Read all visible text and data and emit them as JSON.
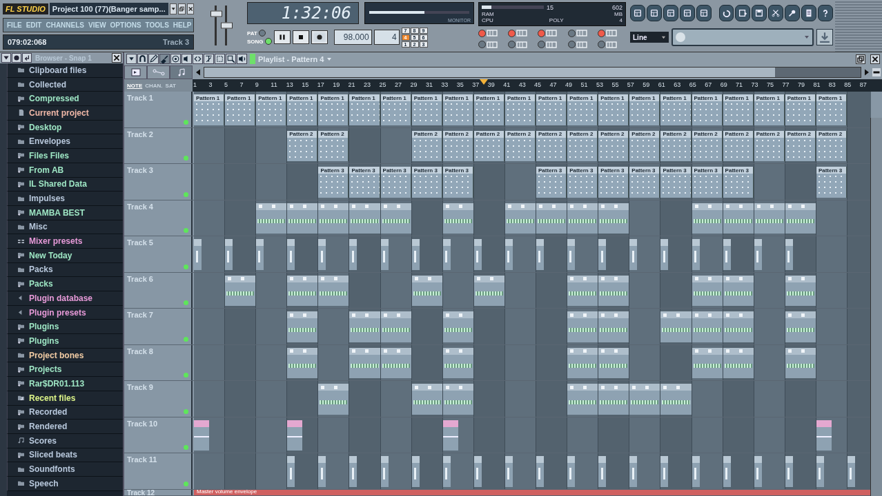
{
  "app": {
    "logo": "FL STUDIO",
    "title": "Project 100 (77)(Banger samp...",
    "menu": [
      "FILE",
      "EDIT",
      "CHANNELS",
      "VIEW",
      "OPTIONS",
      "TOOLS",
      "HELP"
    ],
    "hint_position": "079:02:068",
    "hint_text": "Track 3"
  },
  "sliders": [
    {
      "level": 0.8
    },
    {
      "level": 0.5
    }
  ],
  "clock": {
    "time": "1:32:06"
  },
  "monitor": {
    "label": "MONITOR",
    "level": 0.55
  },
  "transport": {
    "modes": [
      {
        "label": "PAT",
        "selected": false
      },
      {
        "label": "SONG",
        "selected": true
      }
    ],
    "playing": false,
    "recording": true,
    "tempo": "98.000",
    "pattern": "4",
    "numpad": [
      {
        "label": "7",
        "selected": false
      },
      {
        "label": "8",
        "selected": false
      },
      {
        "label": "9",
        "selected": false
      },
      {
        "label": "4",
        "selected": true
      },
      {
        "label": "5",
        "selected": false
      },
      {
        "label": "6",
        "selected": false
      },
      {
        "label": "1",
        "selected": false
      },
      {
        "label": "2",
        "selected": false
      },
      {
        "label": "3",
        "selected": false
      }
    ]
  },
  "cpu": {
    "cpu_value": "15",
    "ram_value": "602",
    "ram_label": "RAM",
    "mb_label": "MB",
    "cpu_label": "CPU",
    "poly_label": "POLY",
    "poly_value": "4",
    "level": 0.15
  },
  "options": [
    {
      "on": true
    },
    {
      "on": true
    },
    {
      "on": true
    },
    {
      "on": false
    },
    {
      "on": true
    },
    {
      "on": false
    },
    {
      "on": false
    },
    {
      "on": false
    },
    {
      "on": false
    },
    {
      "on": false
    }
  ],
  "snap": {
    "value": "Line"
  },
  "browser": {
    "title": "Browser - Snap 1",
    "items": [
      {
        "name": "Clipboard files",
        "kind": "folder",
        "color": "#b8c8dc"
      },
      {
        "name": "Collected",
        "kind": "folder",
        "color": "#b8c8dc"
      },
      {
        "name": "Compressed",
        "kind": "linked",
        "color": "#9ee6c4"
      },
      {
        "name": "Current project",
        "kind": "file",
        "color": "#f0b8a8"
      },
      {
        "name": "Desktop",
        "kind": "linked",
        "color": "#9ee6c4"
      },
      {
        "name": "Envelopes",
        "kind": "folder",
        "color": "#b8c8dc"
      },
      {
        "name": "Files Files",
        "kind": "linked",
        "color": "#9ee6c4"
      },
      {
        "name": "From AB",
        "kind": "linked",
        "color": "#9ee6c4"
      },
      {
        "name": "IL Shared Data",
        "kind": "linked",
        "color": "#9ee6c4"
      },
      {
        "name": "Impulses",
        "kind": "folder",
        "color": "#b8c8dc"
      },
      {
        "name": "MAMBA BEST",
        "kind": "linked",
        "color": "#9ee6c4"
      },
      {
        "name": "Misc",
        "kind": "folder",
        "color": "#b8c8dc"
      },
      {
        "name": "Mixer presets",
        "kind": "mixer",
        "color": "#e79ad8"
      },
      {
        "name": "New Today",
        "kind": "linked",
        "color": "#9ee6c4"
      },
      {
        "name": "Packs",
        "kind": "folder",
        "color": "#b8c8dc"
      },
      {
        "name": "Packs",
        "kind": "linked",
        "color": "#9ee6c4"
      },
      {
        "name": "Plugin database",
        "kind": "plugin",
        "color": "#e79ad8"
      },
      {
        "name": "Plugin presets",
        "kind": "plugin",
        "color": "#e79ad8"
      },
      {
        "name": "Plugins",
        "kind": "linked",
        "color": "#9ee6c4"
      },
      {
        "name": "Plugins",
        "kind": "linked",
        "color": "#9ee6c4"
      },
      {
        "name": "Project bones",
        "kind": "folder",
        "color": "#f2cca4"
      },
      {
        "name": "Projects",
        "kind": "linked",
        "color": "#9ee6c4"
      },
      {
        "name": "Rar$DR01.113",
        "kind": "linked",
        "color": "#9ee6c4"
      },
      {
        "name": "Recent files",
        "kind": "recent",
        "color": "#dcf488"
      },
      {
        "name": "Recorded",
        "kind": "linked",
        "color": "#b8c8dc"
      },
      {
        "name": "Rendered",
        "kind": "linked",
        "color": "#b8c8dc"
      },
      {
        "name": "Scores",
        "kind": "score",
        "color": "#b8c8dc"
      },
      {
        "name": "Sliced beats",
        "kind": "linked",
        "color": "#b8c8dc"
      },
      {
        "name": "Soundfonts",
        "kind": "folder",
        "color": "#b8c8dc"
      },
      {
        "name": "Speech",
        "kind": "folder",
        "color": "#b8c8dc"
      }
    ]
  },
  "playlist": {
    "title": "Playlist - Pattern 4",
    "view_tabs": [
      {
        "selected": false
      },
      {
        "selected": false
      },
      {
        "selected": true
      }
    ],
    "filters": [
      {
        "label": "NOTE",
        "selected": true
      },
      {
        "label": "CHAN.",
        "selected": false
      },
      {
        "label": "SAT",
        "selected": false
      }
    ],
    "ruler": [
      "1",
      "3",
      "5",
      "7",
      "9",
      "11",
      "13",
      "15",
      "17",
      "19",
      "21",
      "23",
      "25",
      "27",
      "29",
      "31",
      "33",
      "35",
      "37",
      "39",
      "41",
      "43",
      "45",
      "47",
      "49",
      "51",
      "53",
      "55",
      "57",
      "59",
      "61",
      "63",
      "65",
      "67",
      "69",
      "71",
      "73",
      "75",
      "77",
      "79",
      "81",
      "83",
      "85",
      "87"
    ],
    "playhead": {
      "level": 0.43
    },
    "tracks": [
      {
        "name": "Track 1",
        "enabled": true,
        "kind": "pattern",
        "slots": [
          {
            "filled": true,
            "label": "Pattern 1"
          },
          {
            "filled": true,
            "label": "Pattern 1"
          },
          {
            "filled": true,
            "label": "Pattern 1"
          },
          {
            "filled": true,
            "label": "Pattern 1"
          },
          {
            "filled": true,
            "label": "Pattern 1"
          },
          {
            "filled": true,
            "label": "Pattern 1"
          },
          {
            "filled": true,
            "label": "Pattern 1"
          },
          {
            "filled": true,
            "label": "Pattern 1"
          },
          {
            "filled": true,
            "label": "Pattern 1"
          },
          {
            "filled": true,
            "label": "Pattern 1"
          },
          {
            "filled": true,
            "label": "Pattern 1"
          },
          {
            "filled": true,
            "label": "Pattern 1"
          },
          {
            "filled": true,
            "label": "Pattern 1"
          },
          {
            "filled": true,
            "label": "Pattern 1"
          },
          {
            "filled": true,
            "label": "Pattern 1"
          },
          {
            "filled": true,
            "label": "Pattern 1"
          },
          {
            "filled": true,
            "label": "Pattern 1"
          },
          {
            "filled": true,
            "label": "Pattern 1"
          },
          {
            "filled": true,
            "label": "Pattern 1"
          },
          {
            "filled": true,
            "label": "Pattern 1"
          },
          {
            "filled": true,
            "label": "Pattern 1"
          },
          {
            "filled": false
          }
        ]
      },
      {
        "name": "Track 2",
        "enabled": true,
        "kind": "pattern",
        "slots": [
          {
            "filled": false
          },
          {
            "filled": false
          },
          {
            "filled": false
          },
          {
            "filled": true,
            "label": "Pattern 2"
          },
          {
            "filled": true,
            "label": "Pattern 2"
          },
          {
            "filled": false
          },
          {
            "filled": false
          },
          {
            "filled": true,
            "label": "Pattern 2"
          },
          {
            "filled": true,
            "label": "Pattern 2"
          },
          {
            "filled": true,
            "label": "Pattern 2"
          },
          {
            "filled": true,
            "label": "Pattern 2"
          },
          {
            "filled": true,
            "label": "Pattern 2"
          },
          {
            "filled": true,
            "label": "Pattern 2"
          },
          {
            "filled": true,
            "label": "Pattern 2"
          },
          {
            "filled": true,
            "label": "Pattern 2"
          },
          {
            "filled": true,
            "label": "Pattern 2"
          },
          {
            "filled": true,
            "label": "Pattern 2"
          },
          {
            "filled": true,
            "label": "Pattern 2"
          },
          {
            "filled": true,
            "label": "Pattern 2"
          },
          {
            "filled": true,
            "label": "Pattern 2"
          },
          {
            "filled": true,
            "label": "Pattern 2"
          },
          {
            "filled": false
          }
        ]
      },
      {
        "name": "Track 3",
        "enabled": true,
        "kind": "pattern",
        "slots": [
          {
            "filled": false
          },
          {
            "filled": false
          },
          {
            "filled": false
          },
          {
            "filled": false
          },
          {
            "filled": true,
            "label": "Pattern 3"
          },
          {
            "filled": true,
            "label": "Pattern 3"
          },
          {
            "filled": true,
            "label": "Pattern 3"
          },
          {
            "filled": true,
            "label": "Pattern 3"
          },
          {
            "filled": true,
            "label": "Pattern 3"
          },
          {
            "filled": false
          },
          {
            "filled": false
          },
          {
            "filled": true,
            "label": "Pattern 3"
          },
          {
            "filled": true,
            "label": "Pattern 3"
          },
          {
            "filled": true,
            "label": "Pattern 3"
          },
          {
            "filled": true,
            "label": "Pattern 3"
          },
          {
            "filled": true,
            "label": "Pattern 3"
          },
          {
            "filled": true,
            "label": "Pattern 3"
          },
          {
            "filled": true,
            "label": "Pattern 3"
          },
          {
            "filled": false
          },
          {
            "filled": false
          },
          {
            "filled": true,
            "label": "Pattern 3"
          },
          {
            "filled": false
          }
        ]
      },
      {
        "name": "Track 4",
        "enabled": true,
        "kind": "beat",
        "slots": [
          false,
          false,
          true,
          true,
          true,
          true,
          true,
          false,
          true,
          false,
          true,
          true,
          true,
          true,
          false,
          false,
          true,
          true,
          true,
          true,
          false,
          false
        ]
      },
      {
        "name": "Track 5",
        "enabled": true,
        "kind": "hit",
        "slots": [
          true,
          true,
          true,
          true,
          true,
          true,
          true,
          true,
          true,
          true,
          true,
          true,
          true,
          true,
          true,
          true,
          true,
          true,
          true,
          true,
          false,
          false
        ]
      },
      {
        "name": "Track 6",
        "enabled": true,
        "kind": "beat",
        "slots": [
          false,
          true,
          false,
          true,
          true,
          false,
          false,
          true,
          false,
          true,
          false,
          false,
          true,
          true,
          false,
          false,
          true,
          true,
          false,
          true,
          false,
          false
        ]
      },
      {
        "name": "Track 7",
        "enabled": true,
        "kind": "beat",
        "slots": [
          false,
          false,
          false,
          true,
          false,
          true,
          true,
          false,
          true,
          false,
          false,
          false,
          true,
          true,
          false,
          true,
          true,
          true,
          false,
          true,
          false,
          false
        ]
      },
      {
        "name": "Track 8",
        "enabled": true,
        "kind": "beat",
        "slots": [
          false,
          false,
          false,
          true,
          false,
          true,
          true,
          false,
          true,
          false,
          false,
          false,
          true,
          true,
          false,
          false,
          true,
          true,
          false,
          true,
          false,
          false
        ]
      },
      {
        "name": "Track 9",
        "enabled": true,
        "kind": "beat",
        "slots": [
          false,
          false,
          false,
          false,
          true,
          false,
          false,
          true,
          true,
          false,
          false,
          false,
          true,
          true,
          true,
          true,
          false,
          false,
          false,
          false,
          false,
          false
        ]
      },
      {
        "name": "Track 10",
        "enabled": true,
        "kind": "automation",
        "slots": [
          true,
          false,
          false,
          true,
          false,
          false,
          false,
          false,
          true,
          false,
          false,
          false,
          false,
          false,
          false,
          false,
          false,
          false,
          false,
          false,
          true,
          false
        ]
      },
      {
        "name": "Track 11",
        "enabled": true,
        "kind": "hit",
        "slots": [
          false,
          false,
          false,
          true,
          true,
          true,
          true,
          true,
          true,
          true,
          true,
          true,
          true,
          true,
          true,
          true,
          true,
          true,
          true,
          true,
          true,
          true
        ]
      },
      {
        "name": "Track 12",
        "kind": "envelope",
        "label": "Master volume envelope"
      }
    ]
  }
}
